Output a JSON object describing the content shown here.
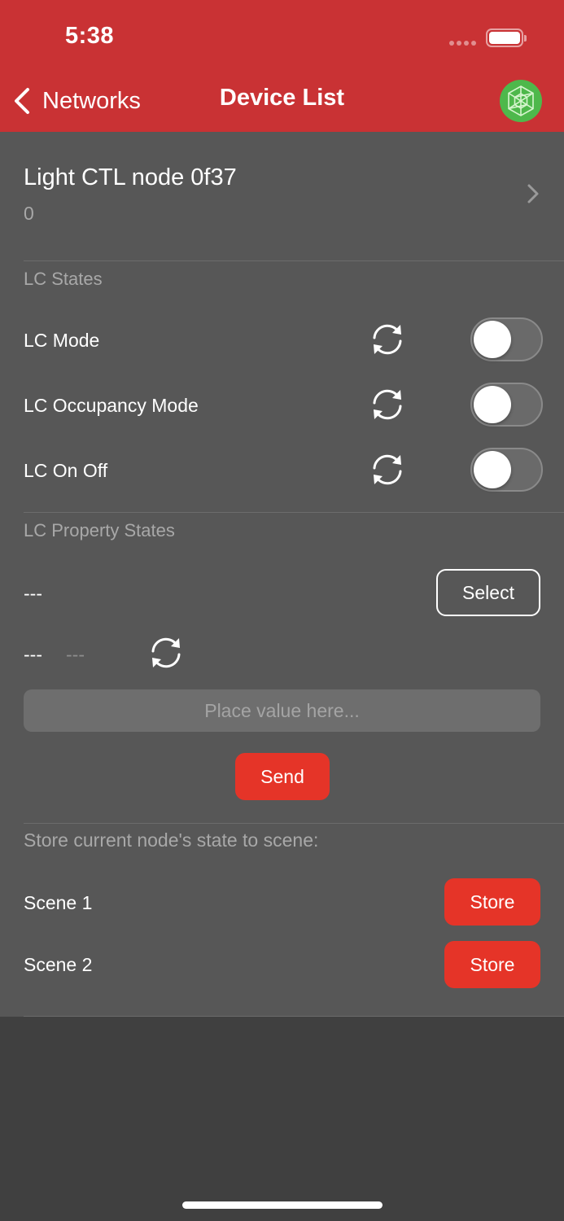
{
  "status_bar": {
    "time": "5:38"
  },
  "nav": {
    "back_label": "Networks",
    "title": "Device List"
  },
  "device": {
    "name": "Light CTL node 0f37",
    "subtitle": "0"
  },
  "lc_states": {
    "header": "LC States",
    "rows": [
      {
        "label": "LC Mode",
        "on": false
      },
      {
        "label": "LC Occupancy Mode",
        "on": false
      },
      {
        "label": "LC On Off",
        "on": false
      }
    ]
  },
  "lc_property_states": {
    "header": "LC Property States",
    "property_name": "---",
    "select_label": "Select",
    "value_label": "---",
    "value_current": "---",
    "input": {
      "placeholder": "Place value here...",
      "value": ""
    },
    "send_label": "Send"
  },
  "scenes": {
    "header": "Store current node's state to scene:",
    "items": [
      {
        "label": "Scene 1",
        "button": "Store"
      },
      {
        "label": "Scene 2",
        "button": "Store"
      }
    ]
  },
  "colors": {
    "header_red": "#c93234",
    "accent_red": "#e53428",
    "panel": "#575757",
    "background": "#404040",
    "avatar_green": "#4eb84b"
  },
  "icons": {
    "back": "chevron-left-icon",
    "avatar": "network-avatar-icon",
    "disclosure": "chevron-right-icon",
    "refresh": "refresh-icon"
  }
}
